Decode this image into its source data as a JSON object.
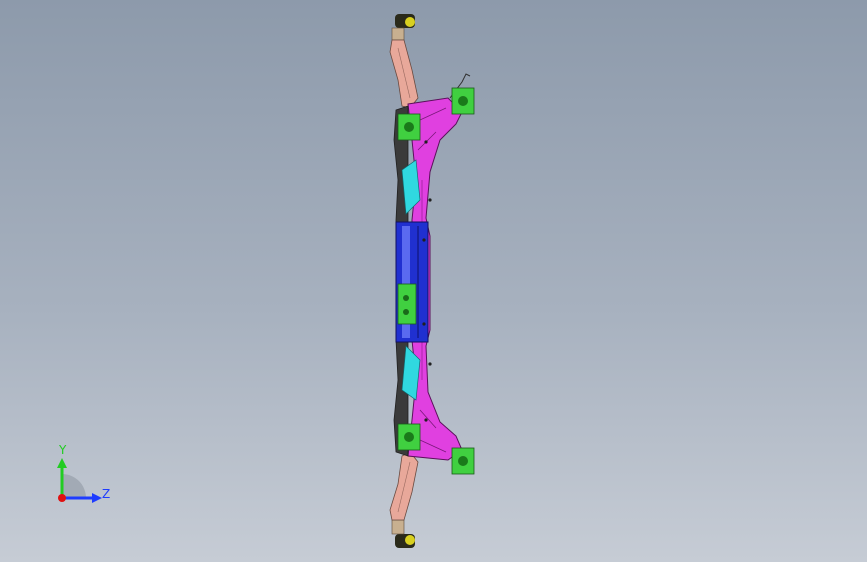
{
  "triad": {
    "y_label": "Y",
    "z_label": "Z",
    "y_color": "#22cc22",
    "z_color": "#1e3cff",
    "origin_color": "#e01010"
  },
  "colors": {
    "background_top": "#8d9aab",
    "background_bottom": "#c6ccd5",
    "pink_part": "#e8a89a",
    "magenta_part": "#e040e0",
    "green_part": "#40d040",
    "blue_part": "#2030d0",
    "cyan_part": "#30d8e0"
  }
}
